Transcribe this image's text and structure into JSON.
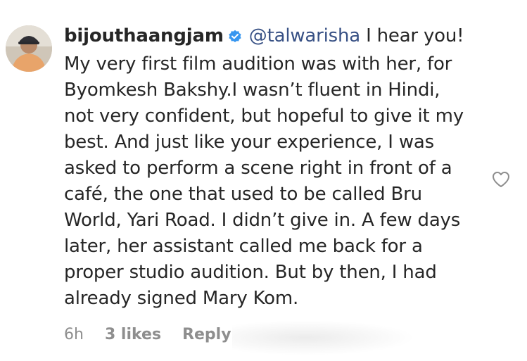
{
  "comment": {
    "username": "bijouthaangjam",
    "verified": true,
    "mention": "@talwarisha",
    "text_lines": [
      " I hear you!",
      "My very first film audition was with her, for",
      "Byomkesh Bakshy.I wasn’t fluent in Hindi,",
      "not very confident, but hopeful to give it my",
      "best. And just like your experience, I was",
      "asked to perform a scene right in front of a",
      "café, the one that used to be called Bru",
      "World, Yari Road. I didn’t give in. A few days",
      "later, her assistant called me back for a",
      "proper studio audition. But by then, I had",
      "already signed Mary Kom."
    ],
    "time": "6h",
    "likes": "3 likes",
    "reply_label": "Reply"
  },
  "icons": {
    "verified": "verified-badge-icon",
    "like": "heart-outline-icon",
    "avatar": "user-avatar"
  },
  "colors": {
    "mention": "#385185",
    "verified": "#3897f0",
    "meta": "#8e8e8e",
    "text": "#262626"
  }
}
